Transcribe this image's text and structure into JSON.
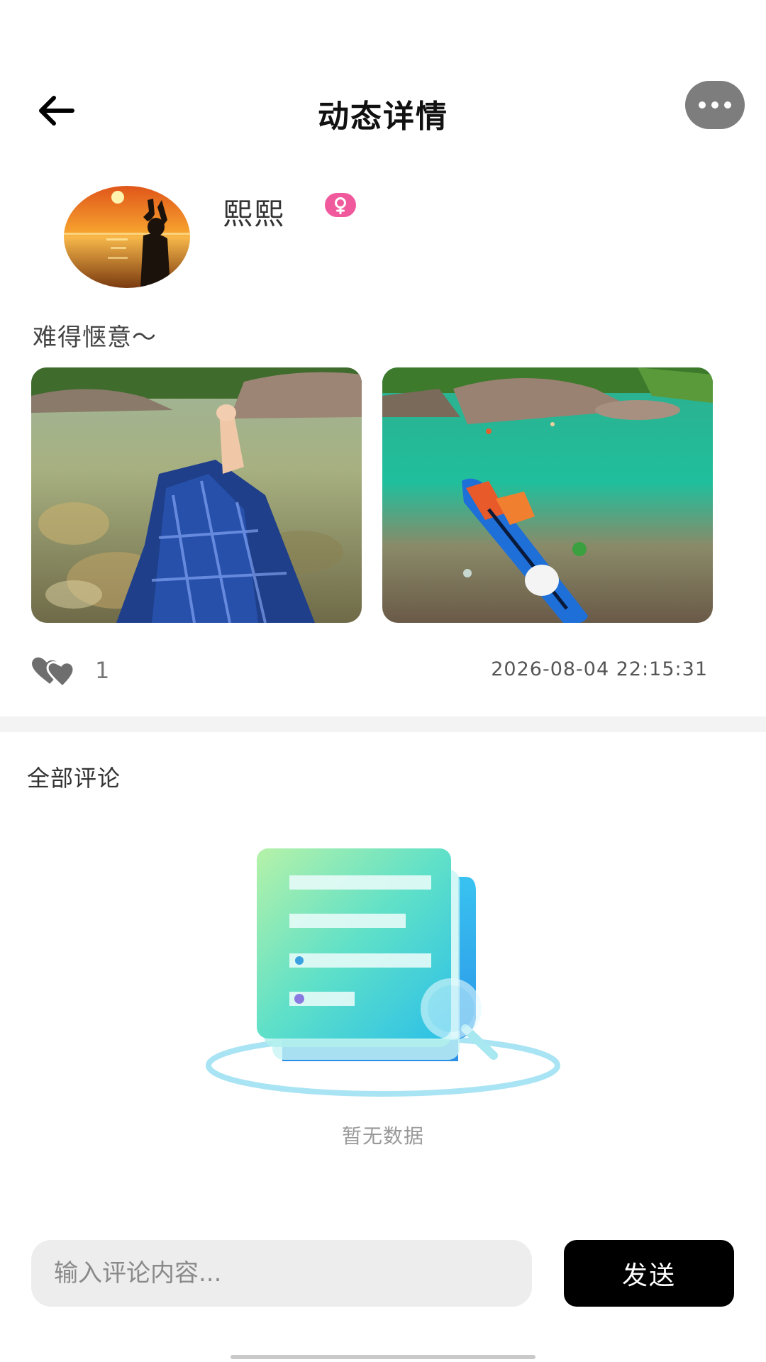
{
  "header": {
    "title": "动态详情"
  },
  "user": {
    "name": "熙熙",
    "gender": "female"
  },
  "post": {
    "text": "难得惬意～",
    "like_count": "1",
    "time": "2026-08-04 22:15:31"
  },
  "comments": {
    "title": "全部评论",
    "empty_text": "暂无数据"
  },
  "composer": {
    "placeholder": "输入评论内容...",
    "send_label": "发送"
  },
  "icons": {
    "back": "arrow-left-icon",
    "more": "more-dots-icon",
    "gender": "female-icon",
    "like": "heart-icon"
  },
  "colors": {
    "gender_badge": "#f05a9c",
    "send_button": "#000000",
    "input_bg": "#ededed"
  }
}
